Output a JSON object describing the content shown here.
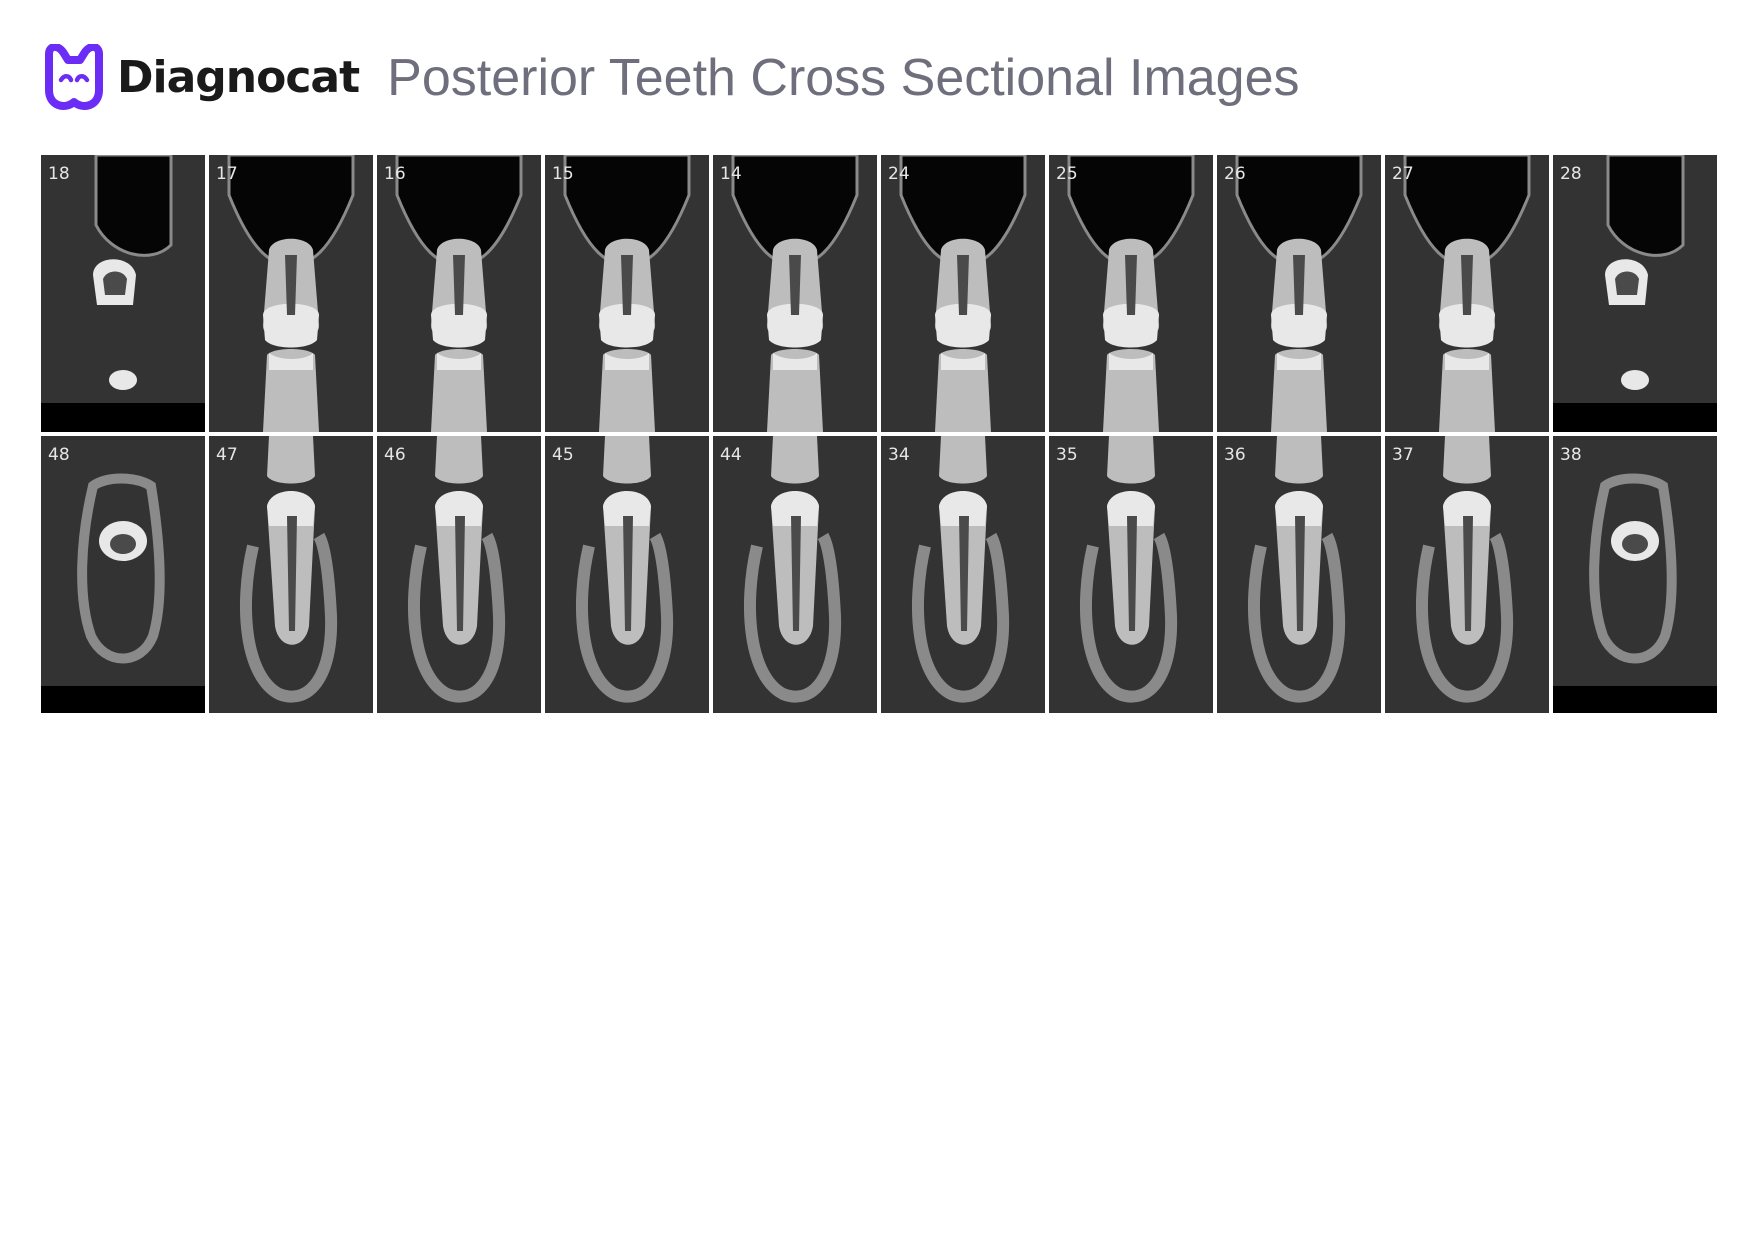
{
  "brand": {
    "name": "Diagnocat",
    "logo_icon": "diagnocat-cat-icon",
    "accent_color": "#6b2cf5"
  },
  "page": {
    "title": "Posterior Teeth Cross Sectional Images"
  },
  "upper_row": [
    {
      "label": "18",
      "jaw": "upper",
      "variant": "sinus-crown"
    },
    {
      "label": "17",
      "jaw": "upper",
      "variant": "molar"
    },
    {
      "label": "16",
      "jaw": "upper",
      "variant": "narrow"
    },
    {
      "label": "15",
      "jaw": "upper",
      "variant": "premolar"
    },
    {
      "label": "14",
      "jaw": "upper",
      "variant": "premolar"
    },
    {
      "label": "24",
      "jaw": "upper",
      "variant": "premolar"
    },
    {
      "label": "25",
      "jaw": "upper",
      "variant": "premolar"
    },
    {
      "label": "26",
      "jaw": "upper",
      "variant": "molar"
    },
    {
      "label": "27",
      "jaw": "upper",
      "variant": "molar"
    },
    {
      "label": "28",
      "jaw": "upper",
      "variant": "sinus-crown"
    }
  ],
  "lower_row": [
    {
      "label": "48",
      "jaw": "lower",
      "variant": "crown-in-bone"
    },
    {
      "label": "47",
      "jaw": "lower",
      "variant": "molar"
    },
    {
      "label": "46",
      "jaw": "lower",
      "variant": "molar"
    },
    {
      "label": "45",
      "jaw": "lower",
      "variant": "premolar"
    },
    {
      "label": "44",
      "jaw": "lower",
      "variant": "premolar"
    },
    {
      "label": "34",
      "jaw": "lower",
      "variant": "premolar"
    },
    {
      "label": "35",
      "jaw": "lower",
      "variant": "premolar"
    },
    {
      "label": "36",
      "jaw": "lower",
      "variant": "molar"
    },
    {
      "label": "37",
      "jaw": "lower",
      "variant": "molar"
    },
    {
      "label": "38",
      "jaw": "lower",
      "variant": "crown-in-bone"
    }
  ]
}
